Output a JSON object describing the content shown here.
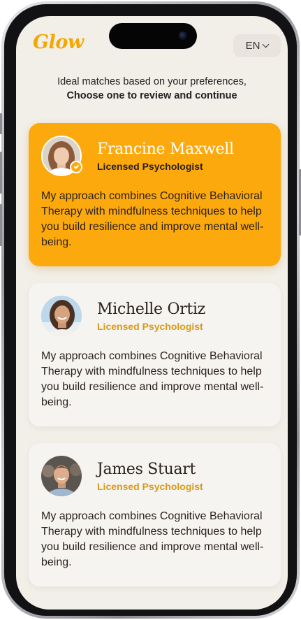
{
  "app": {
    "logo": "Glow",
    "language": "EN"
  },
  "intro": {
    "line1": "Ideal matches based on your preferences,",
    "line2": "Choose one to review and continue"
  },
  "colors": {
    "accent": "#fca90d",
    "background": "#f2efe9",
    "card": "#f6f4f1"
  },
  "therapists": [
    {
      "name": "Francine Maxwell",
      "role": "Licensed Psychologist",
      "description": "My approach combines Cognitive Behavioral Therapy with mindfulness techniques to help you build resilience and improve mental well-being.",
      "selected": true,
      "verified": true
    },
    {
      "name": "Michelle Ortiz",
      "role": "Licensed Psychologist",
      "description": "My approach combines Cognitive Behavioral Therapy with mindfulness techniques to help you build resilience and improve mental well-being.",
      "selected": false,
      "verified": false
    },
    {
      "name": "James Stuart",
      "role": "Licensed Psychologist",
      "description": "My approach combines Cognitive Behavioral Therapy with mindfulness techniques to help you build resilience and improve mental well-being.",
      "selected": false,
      "verified": false
    }
  ]
}
